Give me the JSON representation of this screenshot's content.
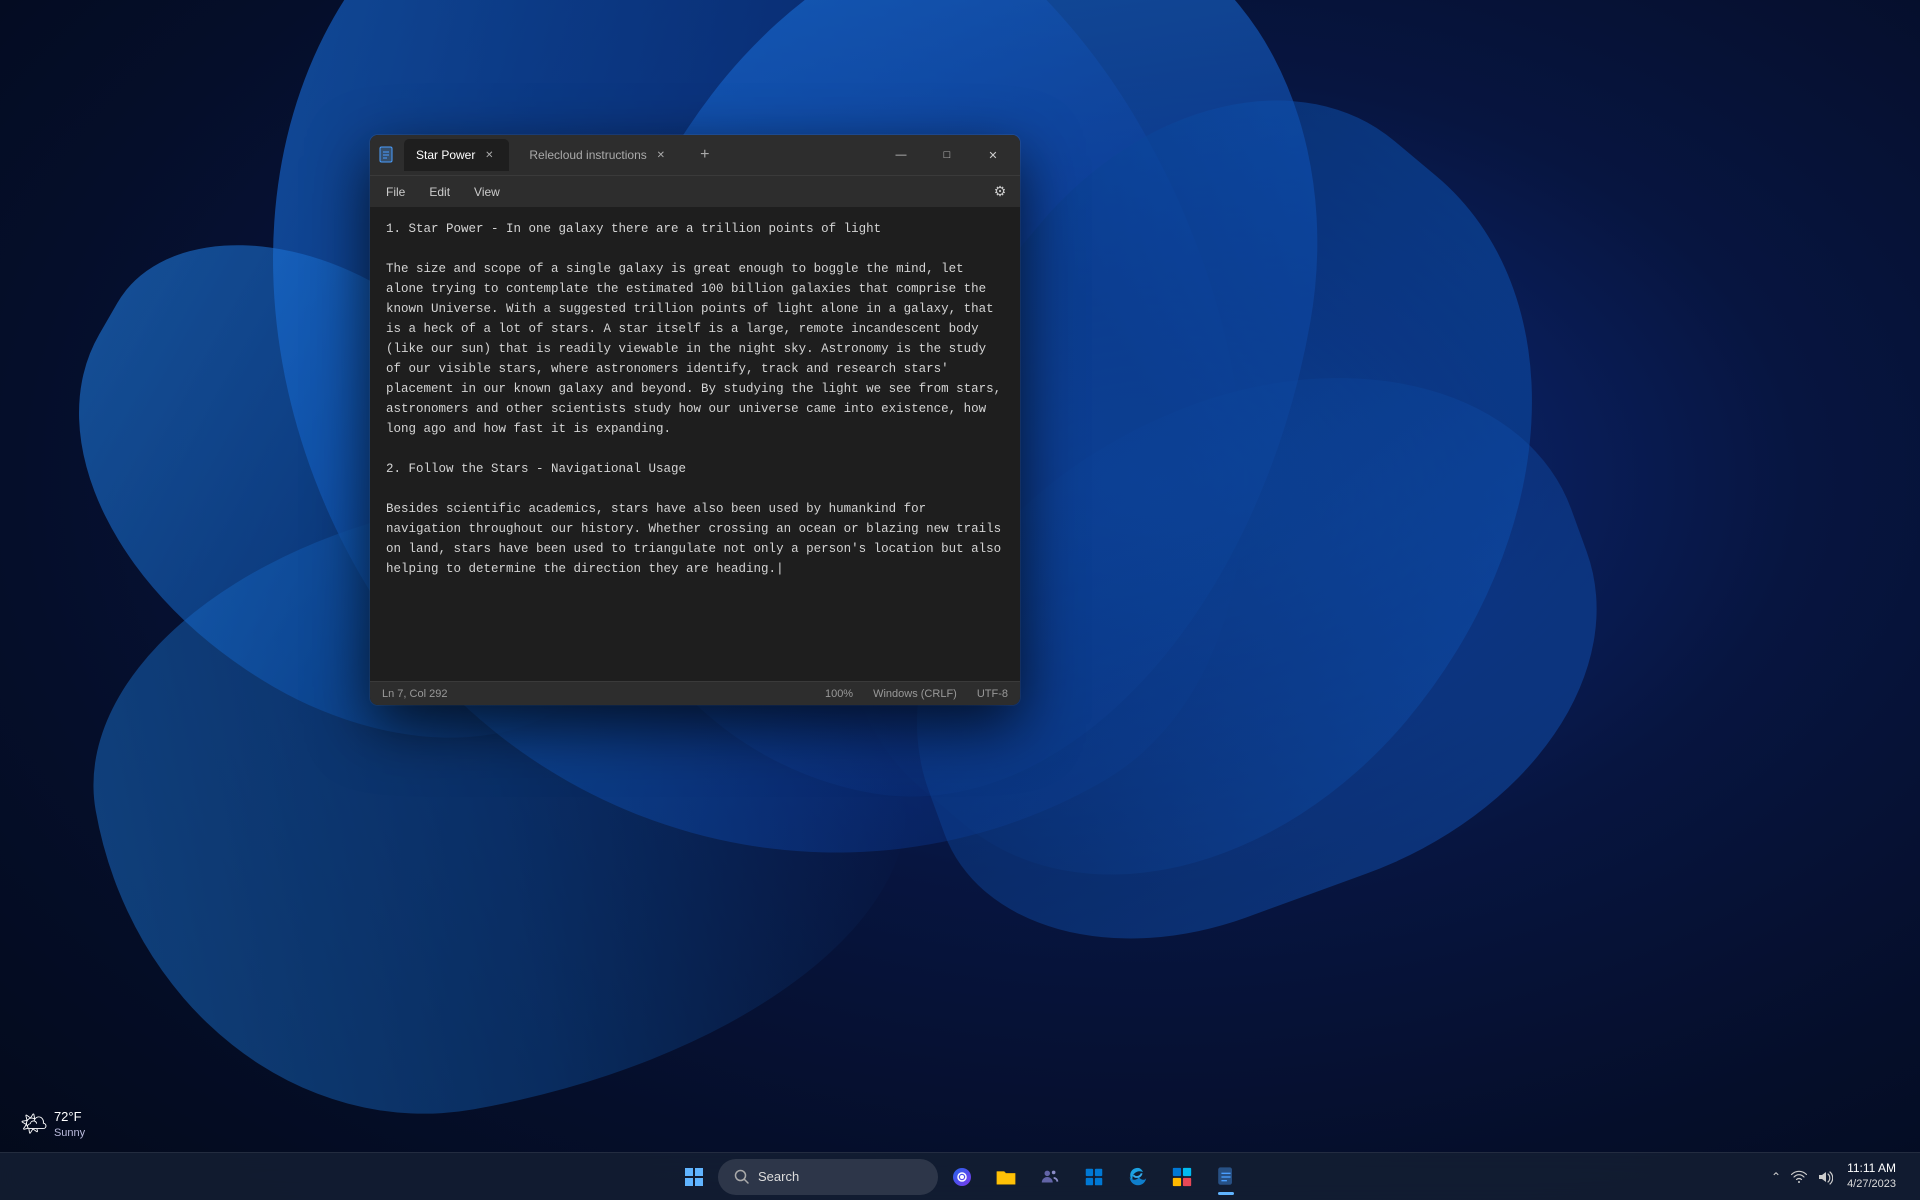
{
  "desktop": {
    "background": "windows11-bloom"
  },
  "notepad": {
    "title": "Star Power",
    "tab_label": "Relecloud instructions",
    "app_icon": "📄",
    "menu": {
      "file": "File",
      "edit": "Edit",
      "view": "View"
    },
    "content_heading1": "1. Star Power - In one galaxy there are a trillion points of light",
    "content_body1": "The size and scope of a single galaxy is great enough to boggle the mind, let alone trying to contemplate the estimated 100 billion galaxies that comprise the known Universe. With a suggested trillion points of light alone in a galaxy, that is a heck of a lot of stars. A star itself is a large, remote incandescent body (like our sun) that is readily viewable in the night sky. Astronomy is the study of our visible stars, where astronomers identify, track and research stars' placement in our known galaxy and beyond. By studying the light we see from stars, astronomers and other scientists study how our universe came into existence, how long ago and how fast it is expanding.",
    "content_heading2": "2. Follow the Stars - Navigational Usage",
    "content_body2": "Besides scientific academics, stars have also been used by humankind for navigation throughout our history. Whether crossing an ocean or blazing new trails on land, stars have been used to triangulate not only a person's location but also helping to determine the direction they are heading.|",
    "statusbar": {
      "position": "Ln 7, Col 292",
      "zoom": "100%",
      "line_ending": "Windows (CRLF)",
      "encoding": "UTF-8"
    }
  },
  "taskbar": {
    "start_icon": "⊞",
    "search_placeholder": "Search",
    "icons": [
      {
        "id": "start",
        "label": "Start",
        "unicode": "⊞"
      },
      {
        "id": "search",
        "label": "Search"
      },
      {
        "id": "copilot",
        "label": "Copilot"
      },
      {
        "id": "files",
        "label": "File Explorer",
        "unicode": "📁"
      },
      {
        "id": "teams",
        "label": "Microsoft Teams",
        "unicode": "👥"
      },
      {
        "id": "explorer",
        "label": "File Explorer",
        "unicode": "📂"
      },
      {
        "id": "edge",
        "label": "Microsoft Edge",
        "unicode": "🌐"
      },
      {
        "id": "store",
        "label": "Microsoft Store",
        "unicode": "🛍"
      },
      {
        "id": "notepad",
        "label": "Notepad",
        "unicode": "📝",
        "active": true
      }
    ],
    "tray": {
      "chevron": "^",
      "wifi": "WiFi",
      "volume": "Volume",
      "time": "11:11 AM",
      "date": "4/27/2023"
    }
  },
  "weather": {
    "icon": "🌤",
    "temp": "72°F",
    "condition": "Sunny"
  },
  "window_controls": {
    "minimize": "—",
    "maximize": "□",
    "close": "✕"
  }
}
